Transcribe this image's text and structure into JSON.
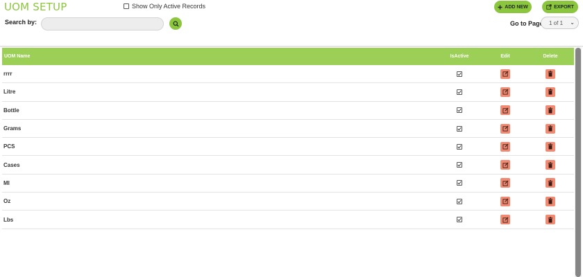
{
  "header": {
    "title": "UOM SETUP",
    "active_filter_label": "Show Only Active Records",
    "search_label": "Search by:",
    "search_placeholder": "",
    "add_new_label": "ADD NEW",
    "export_label": "EXPORT",
    "goto_label": "Go to Page",
    "page_select": "1 of 1"
  },
  "table": {
    "columns": [
      "UOM Name",
      "IsActive",
      "Edit",
      "Delete"
    ],
    "rows": [
      {
        "name": "rrrr",
        "is_active": true
      },
      {
        "name": "Litre",
        "is_active": true
      },
      {
        "name": "Bottle",
        "is_active": true
      },
      {
        "name": "Grams",
        "is_active": true
      },
      {
        "name": "PCS",
        "is_active": true
      },
      {
        "name": "Cases",
        "is_active": true
      },
      {
        "name": "Ml",
        "is_active": true
      },
      {
        "name": "Oz",
        "is_active": true
      },
      {
        "name": "Lbs",
        "is_active": true
      }
    ]
  },
  "colors": {
    "accent": "#8cc63f",
    "header_bg": "#9ccf55",
    "action_bg": "#f08a73"
  },
  "icons": [
    "search-icon",
    "plus-icon",
    "export-icon",
    "chevron-down-icon",
    "check-icon",
    "edit-icon",
    "trash-icon"
  ]
}
